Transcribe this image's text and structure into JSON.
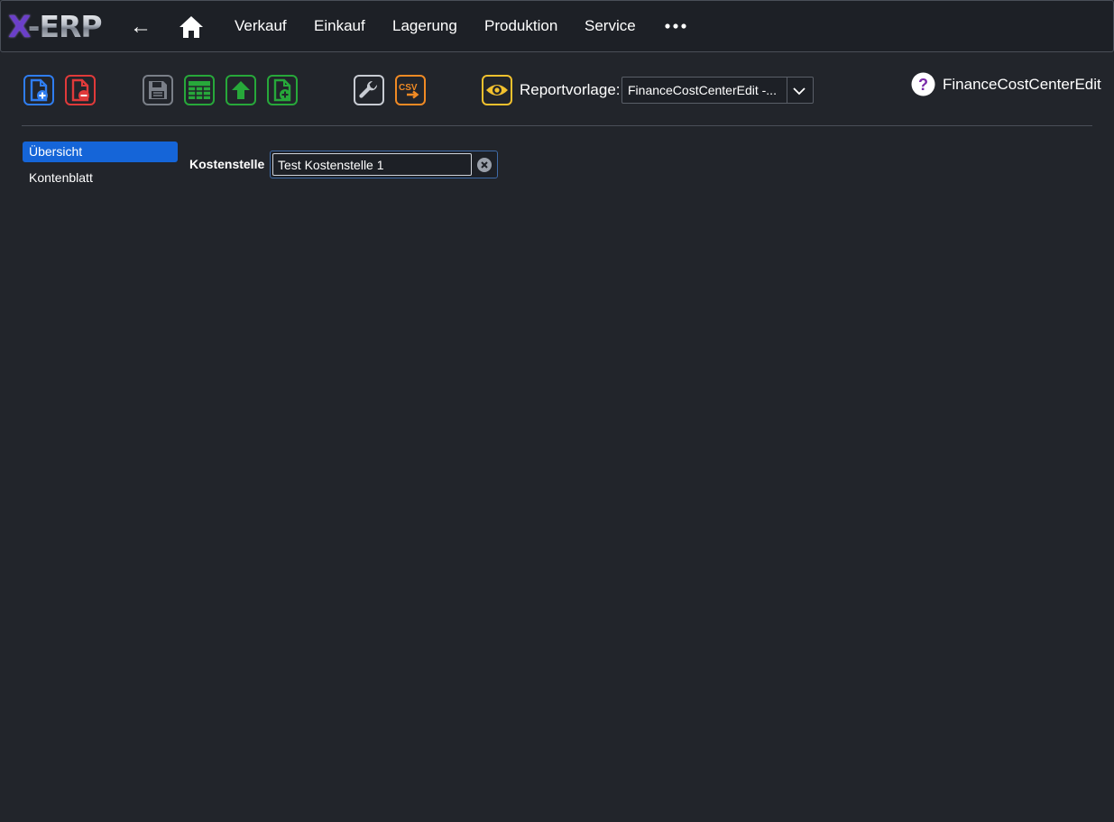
{
  "app": {
    "logo_x": "X",
    "logo_rest": "-ERP"
  },
  "topnav": {
    "back_glyph": "←",
    "items": [
      {
        "label": "Verkauf"
      },
      {
        "label": "Einkauf"
      },
      {
        "label": "Lagerung"
      },
      {
        "label": "Produktion"
      },
      {
        "label": "Service"
      }
    ],
    "icons": [
      "back-arrow-icon",
      "home-icon",
      "more-dots-icon"
    ]
  },
  "toolbar": {
    "buttons": [
      {
        "name": "new-document-button",
        "icon": "file-plus-icon",
        "color": "#2f7df0"
      },
      {
        "name": "delete-document-button",
        "icon": "file-minus-icon",
        "color": "#e03a3a"
      },
      {
        "name": "save-button",
        "icon": "floppy-disk-icon",
        "color": "#7a7f88"
      },
      {
        "name": "table-view-button",
        "icon": "table-icon",
        "color": "#27a83a"
      },
      {
        "name": "upload-button",
        "icon": "upload-arrow-icon",
        "color": "#27a83a"
      },
      {
        "name": "add-file-button",
        "icon": "file-plus-icon",
        "color": "#27a83a"
      },
      {
        "name": "settings-button",
        "icon": "wrench-icon",
        "color": "#c8ccd3"
      },
      {
        "name": "csv-export-button",
        "icon": "csv-export-icon",
        "color": "#f08a24",
        "text": "CSV"
      },
      {
        "name": "preview-button",
        "icon": "eye-icon",
        "color": "#f2c12e"
      }
    ],
    "report_label": "Reportvorlage:",
    "report_value": "FinanceCostCenterEdit -...",
    "page_name": "FinanceCostCenterEdit",
    "help_glyph": "?"
  },
  "sidebar": {
    "items": [
      {
        "label": "Übersicht",
        "active": true
      },
      {
        "label": "Kontenblatt",
        "active": false
      }
    ]
  },
  "form": {
    "cost_center_label": "Kostenstelle",
    "cost_center_value": "Test Kostenstelle 1"
  },
  "colors": {
    "background": "#22252b",
    "topbar": "#1d2026",
    "accent": "#1565d8"
  }
}
